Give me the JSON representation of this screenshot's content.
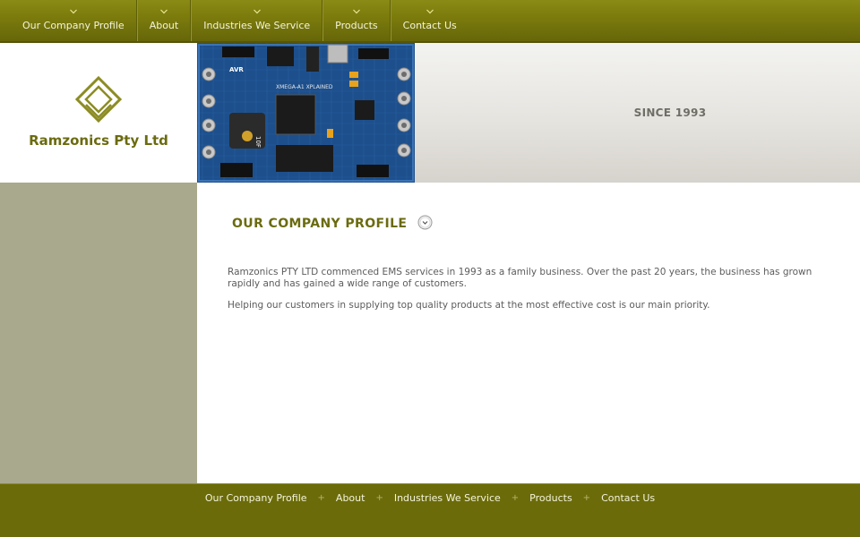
{
  "nav": {
    "items": [
      {
        "label": "Our Company Profile"
      },
      {
        "label": "About"
      },
      {
        "label": "Industries We Service"
      },
      {
        "label": "Products"
      },
      {
        "label": "Contact Us"
      }
    ]
  },
  "brand": {
    "name": "Ramzonics Pty Ltd",
    "logo_icon": "diamond-logo-icon"
  },
  "banner": {
    "tagline": "SINCE 1993",
    "image": "circuit-board-image",
    "board_labels": [
      "XMEGA-A1 XPLAINED",
      "AVR",
      "10F"
    ]
  },
  "main": {
    "heading": "OUR COMPANY PROFILE",
    "paragraphs": [
      "Ramzonics PTY LTD commenced EMS services in 1993 as a family business. Over the past 20 years, the business has grown rapidly and has gained a wide range of customers.",
      "Helping our customers in supplying top quality products at the most effective cost is our main priority."
    ]
  },
  "footer": {
    "links": [
      {
        "label": "Our Company Profile"
      },
      {
        "label": "About"
      },
      {
        "label": "Industries We Service"
      },
      {
        "label": "Products"
      },
      {
        "label": "Contact Us"
      }
    ],
    "separator": "+"
  },
  "colors": {
    "nav_bg": "#7a7a0c",
    "brand_text": "#6b6b10",
    "left_column": "#a9a98d",
    "footer_bg": "#6b6b0a",
    "pcb_blue": "#1d4f8c"
  }
}
